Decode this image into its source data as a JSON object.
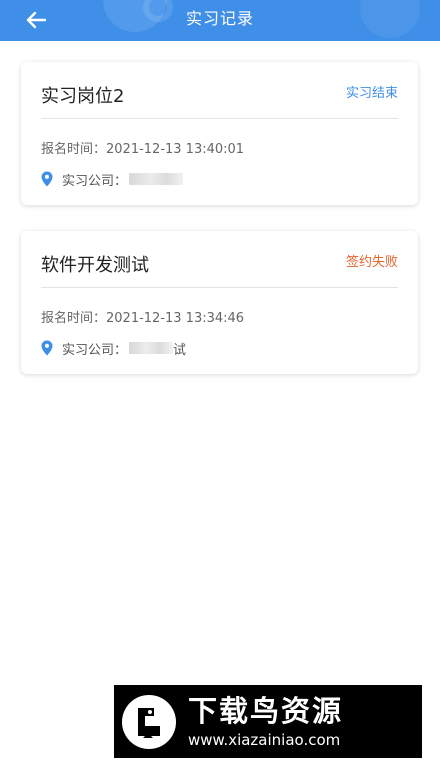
{
  "header": {
    "title": "实习记录",
    "back_icon": "arrow-left-icon",
    "color": "#3f8fe9"
  },
  "records": [
    {
      "title": "实习岗位2",
      "status": "实习结束",
      "status_color": "#3f8fe9",
      "time": "报名时间：2021-12-13 13:40:01",
      "company_label": "实习公司：",
      "company_icon": "location-pin-icon"
    },
    {
      "title": "软件开发测试",
      "status": "签约失败",
      "status_color": "#e8622c",
      "time": "报名时间：2021-12-13 13:34:46",
      "company_label": "实习公司：",
      "company_suffix": "试",
      "company_icon": "location-pin-icon"
    }
  ],
  "watermark": {
    "title": "下载鸟资源",
    "url": "www.xiazainiao.com"
  }
}
